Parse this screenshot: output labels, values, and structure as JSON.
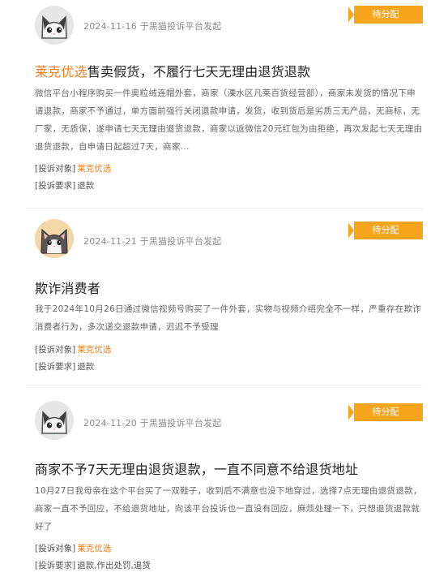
{
  "complaints": [
    {
      "avatar_icon": "white-cat-icon",
      "date": "2024-11-16",
      "platform": "于黑猫投诉平台发起",
      "status": "待分配",
      "title_merchant": "莱克优选",
      "title_rest": "售卖假货，不履行七天无理由退货退款",
      "desc": "微信平台小程序购买一件奥粒绒连帽外套，商家（溧水区凡莱百货经营部），商家未发货的情况下申请退款，商家不予通过，单方面前强行关闭退款申请，发货，收到货后是劣质三无产品，无商标，无厂家，无质保，遂申请七天无理由退货退款，商家以返微信20元红包为由拒绝，再次发起七天无理由退货退款，自申请日起超过7天，商家...",
      "target_label": "[投诉对象]",
      "target_value": "莱克优选",
      "demand_label": "[投诉要求]",
      "demand_value": "退款"
    },
    {
      "avatar_icon": "tabby-cat-icon",
      "date": "2024-11-21",
      "platform": "于黑猫投诉平台发起",
      "status": "待分配",
      "title_merchant": "",
      "title_rest": "欺诈消费者",
      "desc": "我于2024年10月26日通过微信视频号购买了一件外套，实物与视频介绍完全不一样，严重存在欺诈消费者行为，多次递交退款申请，迟迟不予受理",
      "target_label": "[投诉对象]",
      "target_value": "莱克优选",
      "demand_label": "[投诉要求]",
      "demand_value": "退款"
    },
    {
      "avatar_icon": "white-cat-icon",
      "date": "2024-11-20",
      "platform": "于黑猫投诉平台发起",
      "status": "待分配",
      "title_merchant": "",
      "title_rest": "商家不予7天无理由退货退款，一直不同意不给退货地址",
      "desc": "10月27日我母亲在这个平台买了一双鞋子，收到后不满意也没下地穿过，选择7点无理由退货退款，商家一直不予回应，不给退货地址，向该平台投诉也一直没有回应，麻烦处理一下，只想退货退款就好了",
      "target_label": "[投诉对象]",
      "target_value": "莱克优选",
      "demand_label": "[投诉要求]",
      "demand_value": "退款,作出处罚,退货"
    }
  ],
  "colors": {
    "accent": "#f07d1a",
    "badge": "#f7a51c",
    "meta": "#8a8a8a"
  }
}
